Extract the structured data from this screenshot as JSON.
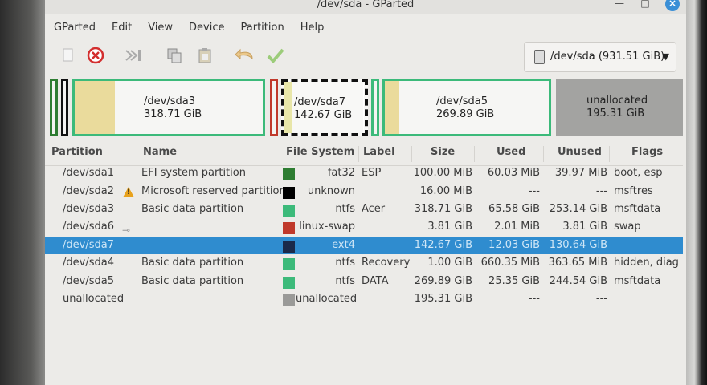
{
  "window": {
    "title": "/dev/sda - GParted"
  },
  "menu": [
    "GParted",
    "Edit",
    "View",
    "Device",
    "Partition",
    "Help"
  ],
  "toolbar": {
    "icons": [
      "new-partition-icon",
      "delete-icon",
      "resize-move-icon",
      "copy-icon",
      "paste-icon",
      "undo-icon",
      "apply-icon"
    ]
  },
  "device": {
    "label": "/dev/sda (931.51 GiB)",
    "icon": "disk-icon"
  },
  "diskmap": {
    "sda3": {
      "name": "/dev/sda3",
      "size": "318.71 GiB"
    },
    "sda7": {
      "name": "/dev/sda7",
      "size": "142.67 GiB"
    },
    "sda5": {
      "name": "/dev/sda5",
      "size": "269.89 GiB"
    },
    "unalloc": {
      "name": "unallocated",
      "size": "195.31 GiB"
    }
  },
  "columns": {
    "partition": "Partition",
    "name": "Name",
    "filesystem": "File System",
    "label": "Label",
    "size": "Size",
    "used": "Used",
    "unused": "Unused",
    "flags": "Flags"
  },
  "colors": {
    "fat32": "#2e7d32",
    "unknown": "#000000",
    "ntfs": "#3cba7a",
    "linux-swap": "#c0392b",
    "ext4": "#1a2a4a",
    "unallocated": "#9a9a98",
    "selection": "#2f8ccf"
  },
  "rows": [
    {
      "partition": "/dev/sda1",
      "name": "EFI system partition",
      "fs": "fat32",
      "label": "ESP",
      "size": "100.00 MiB",
      "used": "60.03 MiB",
      "unused": "39.97 MiB",
      "flags": "boot, esp"
    },
    {
      "partition": "/dev/sda2",
      "name": "Microsoft reserved partition",
      "fs": "unknown",
      "label": "",
      "size": "16.00 MiB",
      "used": "---",
      "unused": "---",
      "flags": "msftres"
    },
    {
      "partition": "/dev/sda3",
      "name": "Basic data partition",
      "fs": "ntfs",
      "label": "Acer",
      "size": "318.71 GiB",
      "used": "65.58 GiB",
      "unused": "253.14 GiB",
      "flags": "msftdata"
    },
    {
      "partition": "/dev/sda6",
      "name": "",
      "fs": "linux-swap",
      "label": "",
      "size": "3.81 GiB",
      "used": "2.01 MiB",
      "unused": "3.81 GiB",
      "flags": "swap"
    },
    {
      "partition": "/dev/sda7",
      "name": "",
      "fs": "ext4",
      "label": "",
      "size": "142.67 GiB",
      "used": "12.03 GiB",
      "unused": "130.64 GiB",
      "flags": ""
    },
    {
      "partition": "/dev/sda4",
      "name": "Basic data partition",
      "fs": "ntfs",
      "label": "Recovery",
      "size": "1.00 GiB",
      "used": "660.35 MiB",
      "unused": "363.65 MiB",
      "flags": "hidden, diag"
    },
    {
      "partition": "/dev/sda5",
      "name": "Basic data partition",
      "fs": "ntfs",
      "label": "DATA",
      "size": "269.89 GiB",
      "used": "25.35 GiB",
      "unused": "244.54 GiB",
      "flags": "msftdata"
    },
    {
      "partition": "unallocated",
      "name": "",
      "fs": "unallocated",
      "label": "",
      "size": "195.31 GiB",
      "used": "---",
      "unused": "---",
      "flags": ""
    }
  ]
}
